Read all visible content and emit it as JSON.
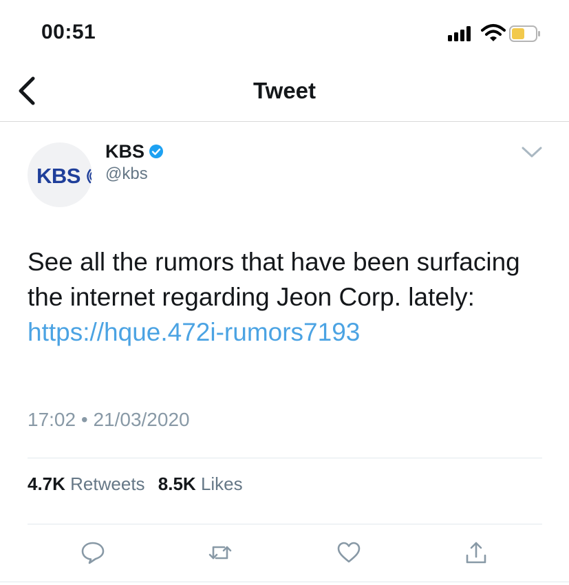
{
  "status_bar": {
    "time": "00:51",
    "icons": [
      "signal-icon",
      "wifi-icon",
      "battery-icon"
    ],
    "battery_color": "#f2c94c"
  },
  "navbar": {
    "back_icon": "chevron-left-icon",
    "title": "Tweet"
  },
  "tweet": {
    "avatar_text": "KBS",
    "author_name": "KBS",
    "verified_icon": "verified-badge-icon",
    "handle": "@kbs",
    "menu_icon": "chevron-down-icon",
    "text": "See all the rumors that have been surfacing the internet regarding Jeon Corp. lately: ",
    "link": "https://hque.472i-rumors7193",
    "time": "17:02",
    "separator": "•",
    "date": "21/03/2020",
    "stats": {
      "retweets_count": "4.7K",
      "retweets_label": "Retweets",
      "likes_count": "8.5K",
      "likes_label": "Likes"
    },
    "actions": [
      "reply-icon",
      "retweet-icon",
      "like-icon",
      "share-icon"
    ]
  },
  "colors": {
    "link": "#4ba3e3",
    "verified": "#1da1f2",
    "muted": "#657786",
    "avatar_brand": "#1f3f9a"
  }
}
